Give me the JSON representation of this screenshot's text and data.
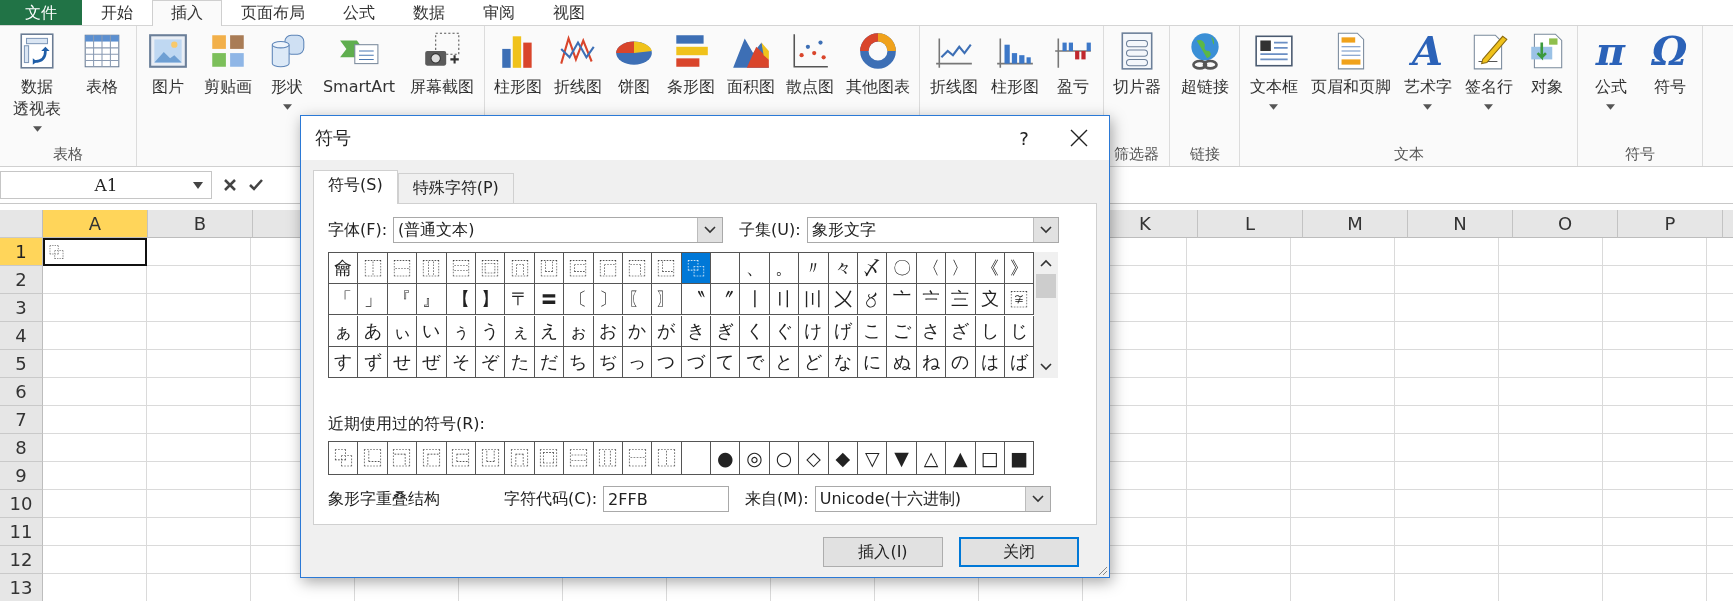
{
  "menu_tabs": [
    {
      "label": "文件",
      "kind": "file",
      "selected": false
    },
    {
      "label": "开始",
      "kind": "tab",
      "selected": false
    },
    {
      "label": "插入",
      "kind": "tab",
      "selected": true
    },
    {
      "label": "页面布局",
      "kind": "tab",
      "selected": false
    },
    {
      "label": "公式",
      "kind": "tab",
      "selected": false
    },
    {
      "label": "数据",
      "kind": "tab",
      "selected": false
    },
    {
      "label": "审阅",
      "kind": "tab",
      "selected": false
    },
    {
      "label": "视图",
      "kind": "tab",
      "selected": false
    }
  ],
  "ribbon": {
    "groups": [
      {
        "label": "表格",
        "items": [
          {
            "kind": "pivot",
            "label": "数据",
            "label_line2": "透视表",
            "dropdown": true
          },
          {
            "kind": "table",
            "label": "表格",
            "dropdown": false
          }
        ]
      },
      {
        "items": [
          {
            "kind": "picture",
            "label": "图片",
            "dropdown": false
          },
          {
            "kind": "clipart",
            "label": "剪贴画",
            "dropdown": false
          },
          {
            "kind": "shapes",
            "label": "形状",
            "dropdown": true
          },
          {
            "kind": "smartart",
            "label": "SmartArt",
            "dropdown": false
          },
          {
            "kind": "screenshot",
            "label": "屏幕截图",
            "dropdown": false
          }
        ]
      },
      {
        "items": [
          {
            "kind": "column",
            "label": "柱形图",
            "dropdown": false
          },
          {
            "kind": "line",
            "label": "折线图",
            "dropdown": false
          },
          {
            "kind": "pie",
            "label": "饼图",
            "dropdown": false
          },
          {
            "kind": "bar",
            "label": "条形图",
            "dropdown": false
          },
          {
            "kind": "area",
            "label": "面积图",
            "dropdown": false
          },
          {
            "kind": "scatter",
            "label": "散点图",
            "dropdown": false
          },
          {
            "kind": "other",
            "label": "其他图表",
            "dropdown": false
          }
        ]
      },
      {
        "items": [
          {
            "kind": "spark-line",
            "label": "折线图",
            "dropdown": false
          },
          {
            "kind": "spark-column",
            "label": "柱形图",
            "dropdown": false
          },
          {
            "kind": "winloss",
            "label": "盈亏",
            "dropdown": false
          }
        ]
      },
      {
        "label": "筛选器",
        "items": [
          {
            "kind": "slicer",
            "label": "切片器",
            "dropdown": false
          }
        ]
      },
      {
        "label": "链接",
        "items": [
          {
            "kind": "hyperlink",
            "label": "超链接",
            "dropdown": false
          }
        ]
      },
      {
        "label": "文本",
        "items": [
          {
            "kind": "textbox",
            "label": "文本框",
            "dropdown": true
          },
          {
            "kind": "header",
            "label": "页眉和页脚",
            "dropdown": false
          },
          {
            "kind": "wordart",
            "glyph": "A",
            "label": "艺术字",
            "dropdown": true
          },
          {
            "kind": "signature",
            "label": "签名行",
            "dropdown": true
          },
          {
            "kind": "object",
            "label": "对象",
            "dropdown": false
          }
        ]
      },
      {
        "label": "符号",
        "items": [
          {
            "kind": "equation",
            "glyph": "π",
            "label": "公式",
            "dropdown": true
          },
          {
            "kind": "symbol",
            "glyph": "Ω",
            "label": "符号",
            "dropdown": false
          }
        ]
      }
    ]
  },
  "formula_bar": {
    "name_box": "A1"
  },
  "sheet": {
    "columns_left": [
      {
        "label": "A",
        "selected": true
      },
      {
        "label": "B",
        "selected": false
      }
    ],
    "columns_right": [
      {
        "label": "K",
        "selected": false
      },
      {
        "label": "L",
        "selected": false
      },
      {
        "label": "M",
        "selected": false
      },
      {
        "label": "N",
        "selected": false
      },
      {
        "label": "O",
        "selected": false
      },
      {
        "label": "P",
        "selected": false
      }
    ],
    "rows": [
      {
        "label": "1",
        "selected": true,
        "cells": [
          "⿻"
        ]
      },
      {
        "label": "2",
        "selected": false
      },
      {
        "label": "3",
        "selected": false
      },
      {
        "label": "4",
        "selected": false
      },
      {
        "label": "5",
        "selected": false
      },
      {
        "label": "6",
        "selected": false
      },
      {
        "label": "7",
        "selected": false
      },
      {
        "label": "8",
        "selected": false
      },
      {
        "label": "9",
        "selected": false
      },
      {
        "label": "10",
        "selected": false
      },
      {
        "label": "11",
        "selected": false
      },
      {
        "label": "12",
        "selected": false
      },
      {
        "label": "13",
        "selected": false
      }
    ]
  },
  "dialog": {
    "title": "符号",
    "help": "?",
    "tabs": [
      {
        "label": "符号(S)",
        "selected": true
      },
      {
        "label": "特殊字符(P)",
        "selected": false
      }
    ],
    "font_label": "字体(F):",
    "font_value": "(普通文本)",
    "subset_label": "子集(U):",
    "subset_value": "象形文字",
    "grid": [
      [
        {
          "kind": "char",
          "ch": "⿕",
          "selected": false
        },
        {
          "kind": "char",
          "ch": "⿰",
          "selected": false
        },
        {
          "kind": "char",
          "ch": "⿱",
          "selected": false
        },
        {
          "kind": "char",
          "ch": "⿲",
          "selected": false
        },
        {
          "kind": "char",
          "ch": "⿳",
          "selected": false
        },
        {
          "kind": "char",
          "ch": "⿴",
          "selected": false
        },
        {
          "kind": "char",
          "ch": "⿵",
          "selected": false
        },
        {
          "kind": "char",
          "ch": "⿶",
          "selected": false
        },
        {
          "kind": "char",
          "ch": "⿷",
          "selected": false
        },
        {
          "kind": "char",
          "ch": "⿸",
          "selected": false
        },
        {
          "kind": "char",
          "ch": "⿹",
          "selected": false
        },
        {
          "kind": "char",
          "ch": "⿺",
          "selected": false
        },
        {
          "kind": "char",
          "ch": "⿻",
          "selected": true
        },
        {
          "kind": "blank",
          "selected": false
        },
        {
          "kind": "char",
          "ch": "、",
          "selected": false
        },
        {
          "kind": "char",
          "ch": "。",
          "selected": false
        },
        {
          "kind": "char",
          "ch": "〃",
          "selected": false
        },
        {
          "kind": "char",
          "ch": "々",
          "selected": false
        },
        {
          "kind": "char",
          "ch": "〆",
          "selected": false
        },
        {
          "kind": "char",
          "ch": "〇",
          "selected": false
        },
        {
          "kind": "char",
          "ch": "〈",
          "selected": false
        },
        {
          "kind": "char",
          "ch": "〉",
          "selected": false
        },
        {
          "kind": "char",
          "ch": "《",
          "selected": false
        },
        {
          "kind": "char",
          "ch": "》",
          "selected": false
        }
      ],
      [
        {
          "kind": "char",
          "ch": "「",
          "selected": false
        },
        {
          "kind": "char",
          "ch": "」",
          "selected": false
        },
        {
          "kind": "char",
          "ch": "『",
          "selected": false
        },
        {
          "kind": "char",
          "ch": "』",
          "selected": false
        },
        {
          "kind": "char",
          "ch": "【",
          "selected": false
        },
        {
          "kind": "char",
          "ch": "】",
          "selected": false
        },
        {
          "kind": "char",
          "ch": "〒",
          "selected": false
        },
        {
          "kind": "char",
          "ch": "〓",
          "selected": false
        },
        {
          "kind": "char",
          "ch": "〔",
          "selected": false
        },
        {
          "kind": "char",
          "ch": "〕",
          "selected": false
        },
        {
          "kind": "char",
          "ch": "〖",
          "selected": false
        },
        {
          "kind": "char",
          "ch": "〗",
          "selected": false
        },
        {
          "kind": "char",
          "ch": "〝",
          "selected": false
        },
        {
          "kind": "char",
          "ch": "〞",
          "selected": false
        },
        {
          "kind": "char",
          "ch": "〡",
          "selected": false
        },
        {
          "kind": "char",
          "ch": "〢",
          "selected": false
        },
        {
          "kind": "char",
          "ch": "〣",
          "selected": false
        },
        {
          "kind": "char",
          "ch": "〤",
          "selected": false
        },
        {
          "kind": "char",
          "ch": "〥",
          "selected": false
        },
        {
          "kind": "char",
          "ch": "〦",
          "selected": false
        },
        {
          "kind": "char",
          "ch": "〧",
          "selected": false
        },
        {
          "kind": "char",
          "ch": "〨",
          "selected": false
        },
        {
          "kind": "char",
          "ch": "〩",
          "selected": false
        },
        {
          "kind": "char",
          "ch": "〾",
          "selected": false
        }
      ],
      [
        {
          "kind": "char",
          "ch": "ぁ",
          "selected": false
        },
        {
          "kind": "char",
          "ch": "あ",
          "selected": false
        },
        {
          "kind": "char",
          "ch": "ぃ",
          "selected": false
        },
        {
          "kind": "char",
          "ch": "い",
          "selected": false
        },
        {
          "kind": "char",
          "ch": "ぅ",
          "selected": false
        },
        {
          "kind": "char",
          "ch": "う",
          "selected": false
        },
        {
          "kind": "char",
          "ch": "ぇ",
          "selected": false
        },
        {
          "kind": "char",
          "ch": "え",
          "selected": false
        },
        {
          "kind": "char",
          "ch": "ぉ",
          "selected": false
        },
        {
          "kind": "char",
          "ch": "お",
          "selected": false
        },
        {
          "kind": "char",
          "ch": "か",
          "selected": false
        },
        {
          "kind": "char",
          "ch": "が",
          "selected": false
        },
        {
          "kind": "char",
          "ch": "き",
          "selected": false
        },
        {
          "kind": "char",
          "ch": "ぎ",
          "selected": false
        },
        {
          "kind": "char",
          "ch": "く",
          "selected": false
        },
        {
          "kind": "char",
          "ch": "ぐ",
          "selected": false
        },
        {
          "kind": "char",
          "ch": "け",
          "selected": false
        },
        {
          "kind": "char",
          "ch": "げ",
          "selected": false
        },
        {
          "kind": "char",
          "ch": "こ",
          "selected": false
        },
        {
          "kind": "char",
          "ch": "ご",
          "selected": false
        },
        {
          "kind": "char",
          "ch": "さ",
          "selected": false
        },
        {
          "kind": "char",
          "ch": "ざ",
          "selected": false
        },
        {
          "kind": "char",
          "ch": "し",
          "selected": false
        },
        {
          "kind": "char",
          "ch": "じ",
          "selected": false
        }
      ],
      [
        {
          "kind": "char",
          "ch": "す",
          "selected": false
        },
        {
          "kind": "char",
          "ch": "ず",
          "selected": false
        },
        {
          "kind": "char",
          "ch": "せ",
          "selected": false
        },
        {
          "kind": "char",
          "ch": "ぜ",
          "selected": false
        },
        {
          "kind": "char",
          "ch": "そ",
          "selected": false
        },
        {
          "kind": "char",
          "ch": "ぞ",
          "selected": false
        },
        {
          "kind": "char",
          "ch": "た",
          "selected": false
        },
        {
          "kind": "char",
          "ch": "だ",
          "selected": false
        },
        {
          "kind": "char",
          "ch": "ち",
          "selected": false
        },
        {
          "kind": "char",
          "ch": "ぢ",
          "selected": false
        },
        {
          "kind": "char",
          "ch": "っ",
          "selected": false
        },
        {
          "kind": "char",
          "ch": "つ",
          "selected": false
        },
        {
          "kind": "char",
          "ch": "づ",
          "selected": false
        },
        {
          "kind": "char",
          "ch": "て",
          "selected": false
        },
        {
          "kind": "char",
          "ch": "で",
          "selected": false
        },
        {
          "kind": "char",
          "ch": "と",
          "selected": false
        },
        {
          "kind": "char",
          "ch": "ど",
          "selected": false
        },
        {
          "kind": "char",
          "ch": "な",
          "selected": false
        },
        {
          "kind": "char",
          "ch": "に",
          "selected": false
        },
        {
          "kind": "char",
          "ch": "ぬ",
          "selected": false
        },
        {
          "kind": "char",
          "ch": "ね",
          "selected": false
        },
        {
          "kind": "char",
          "ch": "の",
          "selected": false
        },
        {
          "kind": "char",
          "ch": "は",
          "selected": false
        },
        {
          "kind": "char",
          "ch": "ば",
          "selected": false
        }
      ]
    ],
    "recent_label": "近期使用过的符号(R):",
    "recent": [
      {
        "kind": "char",
        "ch": "⿻"
      },
      {
        "kind": "char",
        "ch": "⿺"
      },
      {
        "kind": "char",
        "ch": "⿹"
      },
      {
        "kind": "char",
        "ch": "⿸"
      },
      {
        "kind": "char",
        "ch": "⿷"
      },
      {
        "kind": "char",
        "ch": "⿶"
      },
      {
        "kind": "char",
        "ch": "⿵"
      },
      {
        "kind": "char",
        "ch": "⿴"
      },
      {
        "kind": "char",
        "ch": "⿳"
      },
      {
        "kind": "char",
        "ch": "⿲"
      },
      {
        "kind": "char",
        "ch": "⿱"
      },
      {
        "kind": "char",
        "ch": "⿰"
      },
      {
        "kind": "blank"
      },
      {
        "kind": "char",
        "ch": "●"
      },
      {
        "kind": "char",
        "ch": "◎"
      },
      {
        "kind": "char",
        "ch": "○"
      },
      {
        "kind": "char",
        "ch": "◇"
      },
      {
        "kind": "char",
        "ch": "◆"
      },
      {
        "kind": "char",
        "ch": "▽"
      },
      {
        "kind": "char",
        "ch": "▼"
      },
      {
        "kind": "char",
        "ch": "△"
      },
      {
        "kind": "char",
        "ch": "▲"
      },
      {
        "kind": "char",
        "ch": "□"
      },
      {
        "kind": "char",
        "ch": "■"
      }
    ],
    "description": "象形字重叠结构",
    "code_label": "字符代码(C):",
    "code_value": "2FFB",
    "from_label": "来自(M):",
    "from_value": "Unicode(十六进制)",
    "buttons": [
      {
        "label": "插入(I)",
        "default": false
      },
      {
        "label": "关闭",
        "default": true
      }
    ]
  }
}
